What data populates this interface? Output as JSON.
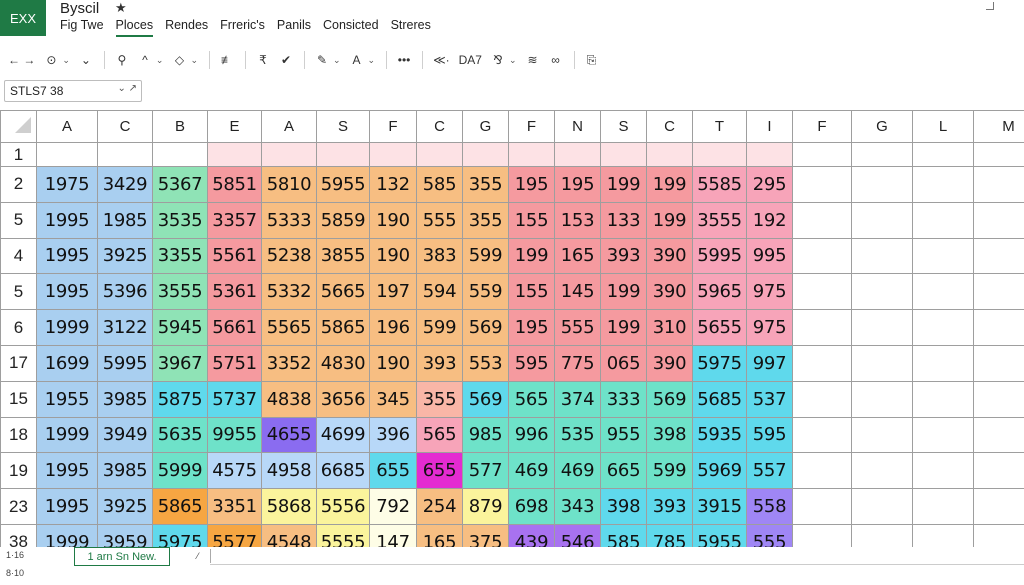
{
  "app": {
    "badge": "EXX",
    "title": "Byscil",
    "star": "★"
  },
  "menu": [
    "Fig Twe",
    "Ploces",
    "Rendes",
    "Frreric's",
    "Panils",
    "Consicted",
    "Streres"
  ],
  "menu_active_index": 1,
  "toolbar": {
    "items": [
      {
        "icon": "undo-redo-icon",
        "glyph": "← →"
      },
      {
        "icon": "history-icon",
        "glyph": "⊙"
      },
      {
        "icon": "chevron-down-icon",
        "glyph": "⌄"
      },
      {
        "icon": "search-icon",
        "glyph": "⚲"
      },
      {
        "icon": "caret-up-icon",
        "glyph": "^"
      },
      {
        "icon": "eraser-icon",
        "glyph": "◇"
      },
      {
        "icon": "align-left-icon",
        "glyph": "≢"
      },
      {
        "icon": "align-center-icon",
        "glyph": "₹"
      },
      {
        "icon": "check-icon",
        "glyph": "✔"
      },
      {
        "icon": "pen-icon",
        "glyph": "✎"
      },
      {
        "icon": "text-color-icon",
        "glyph": "A"
      },
      {
        "icon": "more-icon",
        "glyph": "•••"
      },
      {
        "icon": "decimal-icon",
        "glyph": "≪·"
      },
      {
        "icon": "format-icon",
        "glyph": "DA7"
      },
      {
        "icon": "merge-icon",
        "glyph": "⅋"
      },
      {
        "icon": "wrap-icon",
        "glyph": "≋"
      },
      {
        "icon": "link-icon",
        "glyph": "∞"
      },
      {
        "icon": "paste-icon",
        "glyph": "⎘"
      }
    ]
  },
  "namebox": {
    "value": "STLS7 38",
    "icons": "⌄ ↗"
  },
  "columns": [
    "A",
    "C",
    "B",
    "E",
    "A",
    "S",
    "F",
    "C",
    "G",
    "F",
    "N",
    "S",
    "C",
    "T",
    "I",
    "F",
    "G",
    "L",
    "M"
  ],
  "rows": [
    {
      "label": "1",
      "values": [
        "",
        "",
        "",
        "",
        "",
        "",
        "",
        "",
        "",
        "",
        "",
        "",
        "",
        "",
        ""
      ]
    },
    {
      "label": "2",
      "values": [
        "1975",
        "3429",
        "5367",
        "5851",
        "5810",
        "5955",
        "132",
        "585",
        "355",
        "195",
        "195",
        "199",
        "199",
        "5585",
        "295"
      ]
    },
    {
      "label": "5",
      "values": [
        "1995",
        "1985",
        "3535",
        "3357",
        "5333",
        "5859",
        "190",
        "555",
        "355",
        "155",
        "153",
        "133",
        "199",
        "3555",
        "192"
      ]
    },
    {
      "label": "4",
      "values": [
        "1995",
        "3925",
        "3355",
        "5561",
        "5238",
        "3855",
        "190",
        "383",
        "599",
        "199",
        "165",
        "393",
        "390",
        "5995",
        "995"
      ]
    },
    {
      "label": "5",
      "values": [
        "1995",
        "5396",
        "3555",
        "5361",
        "5332",
        "5665",
        "197",
        "594",
        "559",
        "155",
        "145",
        "199",
        "390",
        "5965",
        "975"
      ]
    },
    {
      "label": "6",
      "values": [
        "1999",
        "3122",
        "5945",
        "5661",
        "5565",
        "5865",
        "196",
        "599",
        "569",
        "195",
        "555",
        "199",
        "310",
        "5655",
        "975"
      ]
    },
    {
      "label": "17",
      "values": [
        "1699",
        "5995",
        "3967",
        "5751",
        "3352",
        "4830",
        "190",
        "393",
        "553",
        "595",
        "775",
        "065",
        "390",
        "5975",
        "997"
      ]
    },
    {
      "label": "15",
      "values": [
        "1955",
        "3985",
        "5875",
        "5737",
        "4838",
        "3656",
        "345",
        "355",
        "569",
        "565",
        "374",
        "333",
        "569",
        "5685",
        "537"
      ]
    },
    {
      "label": "18",
      "values": [
        "1999",
        "3949",
        "5635",
        "9955",
        "4655",
        "4699",
        "396",
        "565",
        "985",
        "996",
        "535",
        "955",
        "398",
        "5935",
        "595"
      ]
    },
    {
      "label": "19",
      "values": [
        "1995",
        "3985",
        "5999",
        "4575",
        "4958",
        "6685",
        "655",
        "655",
        "577",
        "469",
        "469",
        "665",
        "599",
        "5969",
        "557"
      ]
    },
    {
      "label": "23",
      "values": [
        "1995",
        "3925",
        "5865",
        "3351",
        "5868",
        "5556",
        "792",
        "254",
        "879",
        "698",
        "343",
        "398",
        "393",
        "3915",
        "558"
      ]
    },
    {
      "label": "38",
      "values": [
        "1999",
        "3959",
        "5975",
        "5577",
        "4548",
        "5555",
        "147",
        "165",
        "375",
        "439",
        "546",
        "585",
        "785",
        "5955",
        "555"
      ]
    }
  ],
  "colors": {
    "blue": "#a9cff0",
    "green": "#8fe3b6",
    "red": "#f59a9f",
    "orange": "#f7be82",
    "pink": "#f7a4b9",
    "salmon": "#f9b6a7",
    "cyan": "#5fd9ec",
    "teal": "#6ee2c9",
    "purple": "#8a6cf0",
    "magenta": "#e42bd1",
    "yellow": "#fbf49c",
    "lightyellow": "#fefde6",
    "lightblue": "#b8d8f8",
    "lightpink": "#fde2e5",
    "deeporange": "#f6a642",
    "violet": "#a872f0",
    "lilac": "#9f86f5"
  },
  "cell_colors": [
    [
      "",
      "",
      "",
      "lightpink",
      "lightpink",
      "lightpink",
      "lightpink",
      "lightpink",
      "lightpink",
      "lightpink",
      "lightpink",
      "lightpink",
      "lightpink",
      "lightpink",
      "lightpink"
    ],
    [
      "blue",
      "blue",
      "green",
      "red",
      "orange",
      "orange",
      "orange",
      "orange",
      "orange",
      "red",
      "red",
      "red",
      "red",
      "pink",
      "pink"
    ],
    [
      "blue",
      "blue",
      "green",
      "red",
      "orange",
      "orange",
      "orange",
      "orange",
      "orange",
      "red",
      "red",
      "red",
      "red",
      "pink",
      "pink"
    ],
    [
      "blue",
      "blue",
      "green",
      "red",
      "orange",
      "orange",
      "orange",
      "orange",
      "orange",
      "red",
      "red",
      "red",
      "red",
      "pink",
      "pink"
    ],
    [
      "blue",
      "blue",
      "green",
      "red",
      "orange",
      "orange",
      "orange",
      "orange",
      "orange",
      "red",
      "red",
      "red",
      "red",
      "pink",
      "pink"
    ],
    [
      "blue",
      "blue",
      "green",
      "red",
      "orange",
      "orange",
      "orange",
      "orange",
      "orange",
      "red",
      "red",
      "red",
      "red",
      "pink",
      "pink"
    ],
    [
      "blue",
      "blue",
      "green",
      "red",
      "orange",
      "orange",
      "orange",
      "orange",
      "orange",
      "red",
      "red",
      "red",
      "red",
      "cyan",
      "cyan"
    ],
    [
      "blue",
      "blue",
      "cyan",
      "cyan",
      "orange",
      "orange",
      "orange",
      "salmon",
      "cyan",
      "teal",
      "teal",
      "teal",
      "teal",
      "cyan",
      "cyan"
    ],
    [
      "blue",
      "blue",
      "teal",
      "teal",
      "purple",
      "lightblue",
      "lightblue",
      "pink",
      "teal",
      "teal",
      "teal",
      "teal",
      "teal",
      "cyan",
      "cyan"
    ],
    [
      "blue",
      "blue",
      "teal",
      "lightblue",
      "lightblue",
      "lightblue",
      "cyan",
      "magenta",
      "teal",
      "teal",
      "teal",
      "teal",
      "teal",
      "cyan",
      "cyan"
    ],
    [
      "blue",
      "blue",
      "deeporange",
      "orange",
      "yellow",
      "yellow",
      "lightyellow",
      "orange",
      "yellow",
      "teal",
      "teal",
      "cyan",
      "cyan",
      "cyan",
      "lilac"
    ],
    [
      "blue",
      "blue",
      "cyan",
      "deeporange",
      "orange",
      "yellow",
      "lightyellow",
      "orange",
      "orange",
      "violet",
      "violet",
      "cyan",
      "cyan",
      "cyan",
      "lilac"
    ]
  ],
  "footer": {
    "left_top": "1·16",
    "left_bottom": "8·10",
    "sheet_tab": "1 arn Sn New.",
    "slash": "⁄"
  }
}
